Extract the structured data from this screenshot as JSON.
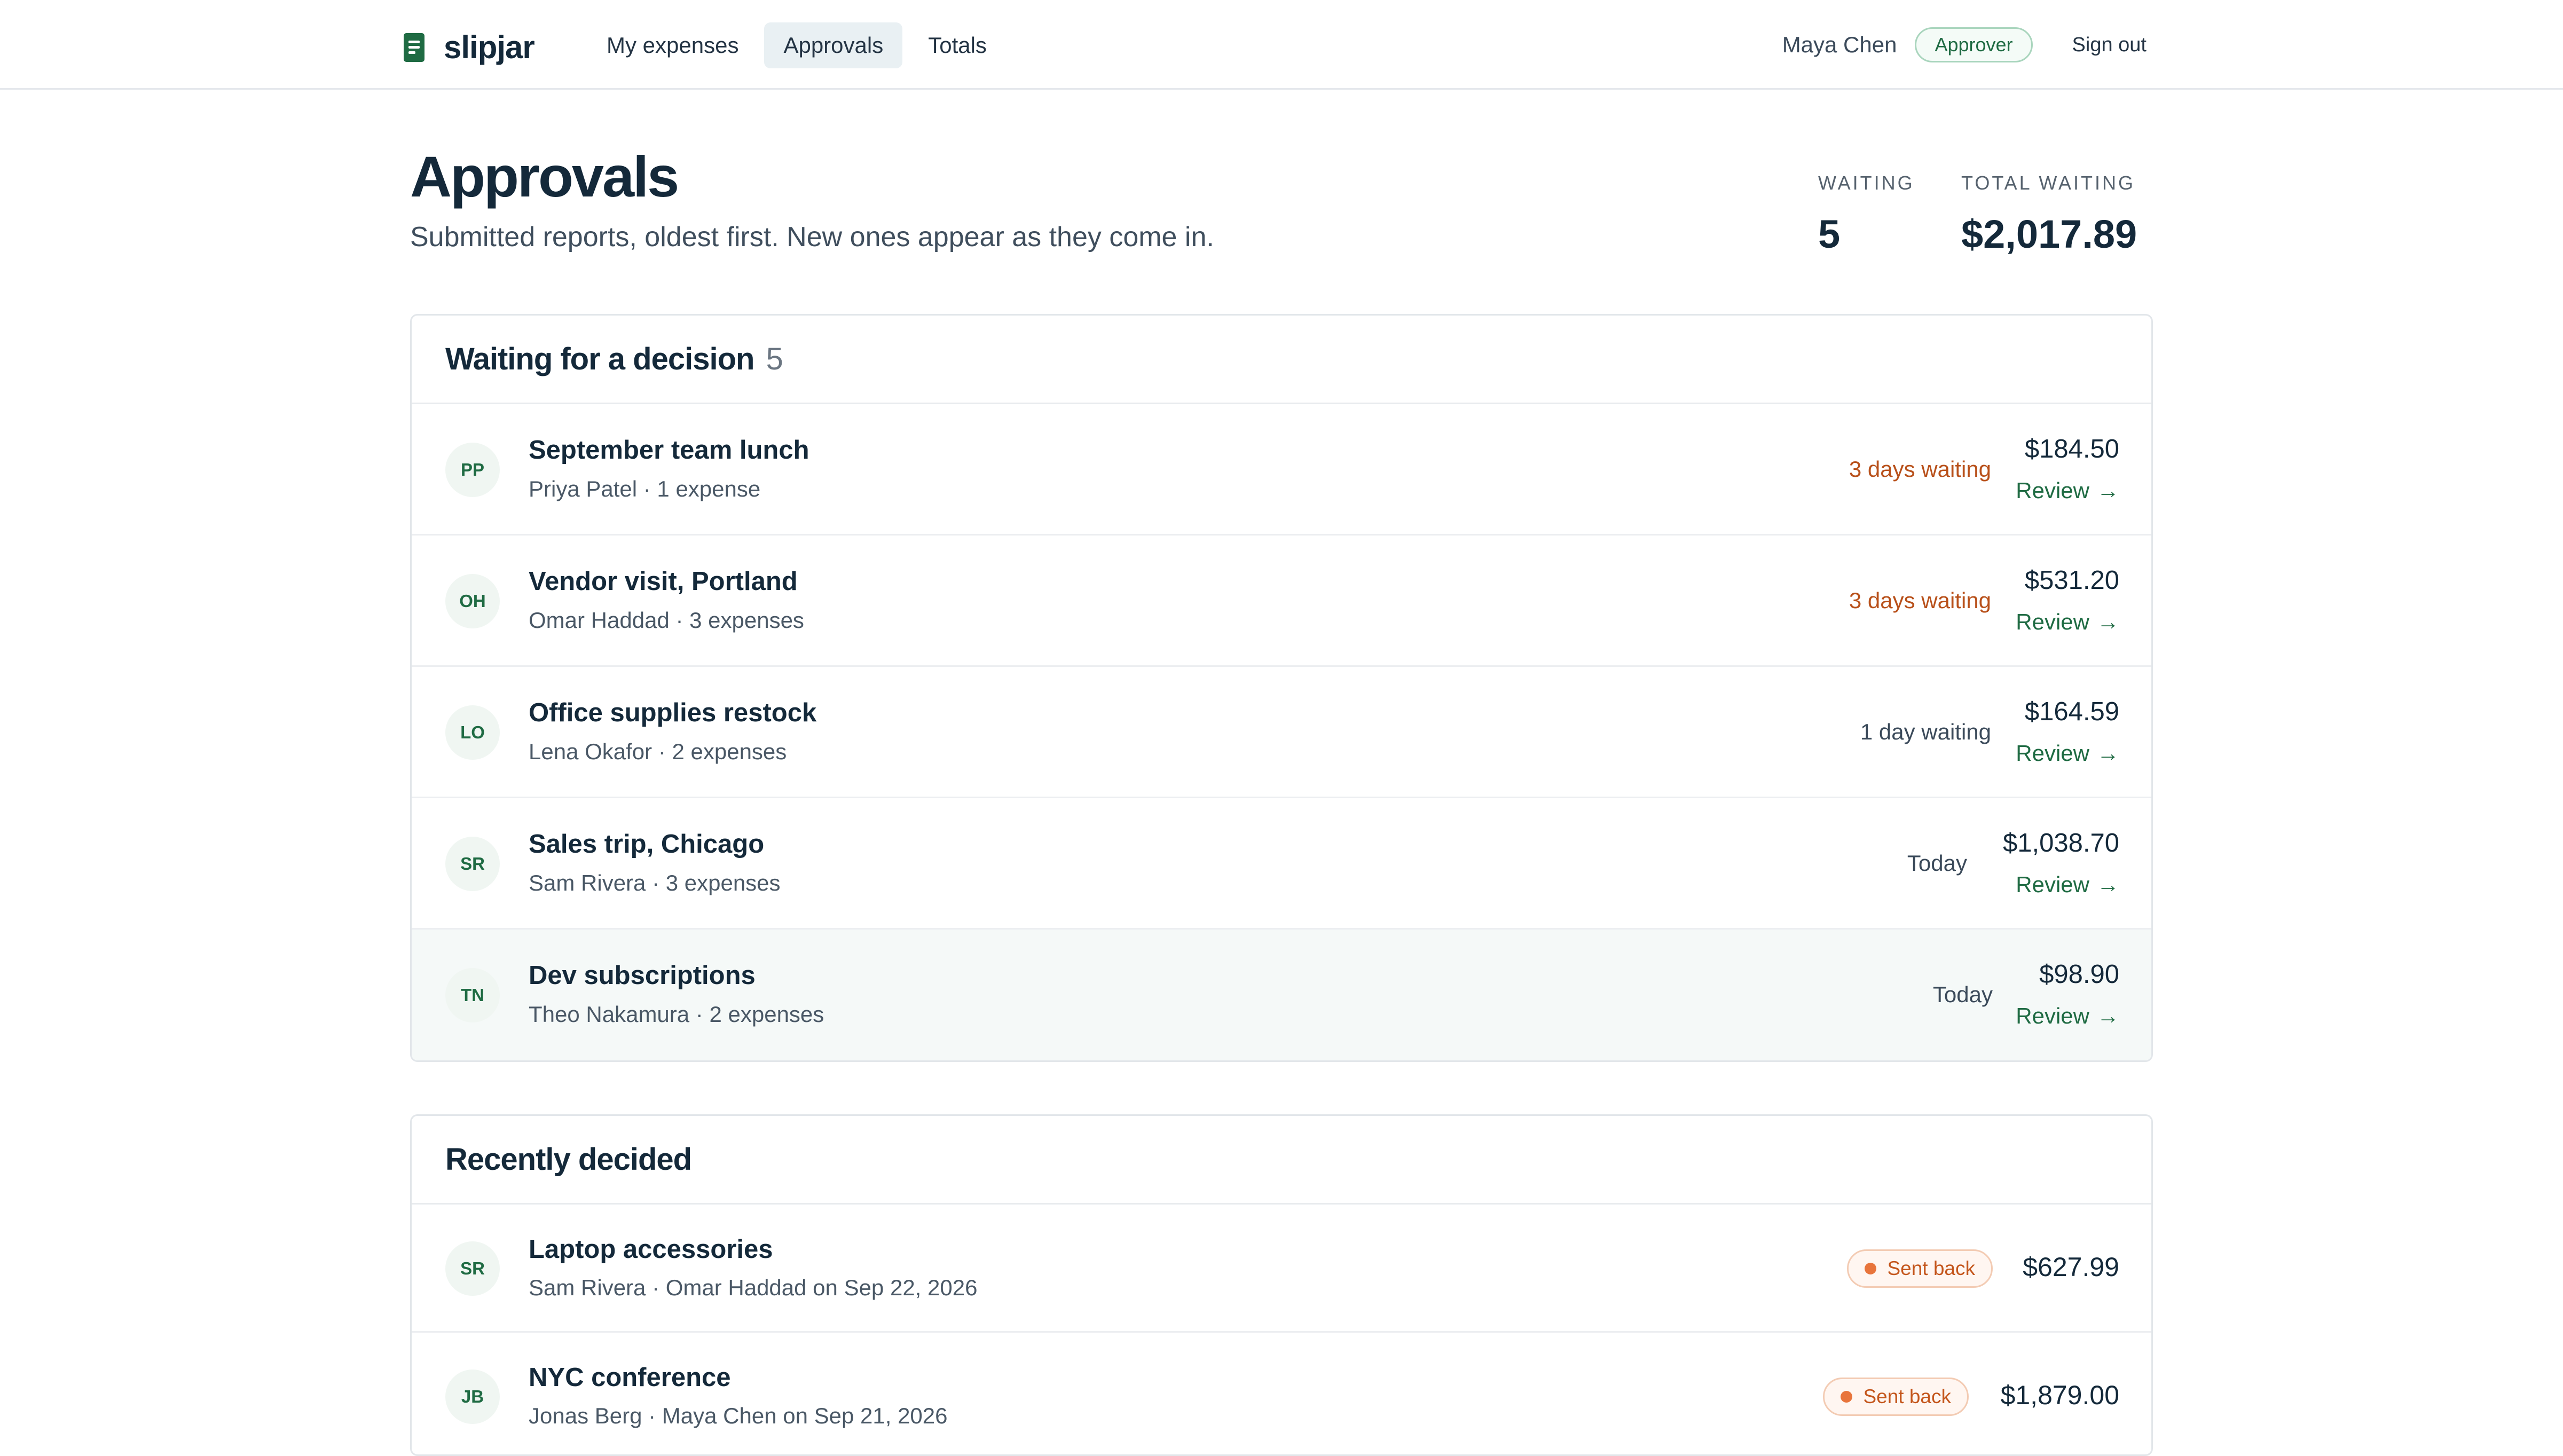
{
  "app": {
    "name": "slipjar"
  },
  "nav": {
    "tabs": [
      "My expenses",
      "Approvals",
      "Totals"
    ],
    "active": "Approvals"
  },
  "user": {
    "name": "Maya Chen",
    "role": "Approver",
    "signout_label": "Sign out"
  },
  "page": {
    "title": "Approvals",
    "subtitle": "Submitted reports, oldest first. New ones appear as they come in."
  },
  "stats": {
    "waiting_label": "WAITING",
    "waiting_value": "5",
    "total_label": "TOTAL WAITING",
    "total_value": "$2,017.89"
  },
  "waiting_section": {
    "title": "Waiting for a decision",
    "count": "5",
    "review_label": "Review",
    "rows": [
      {
        "initials": "PP",
        "title": "September team lunch",
        "meta": "Priya Patel · 1 expense",
        "waiting": "3 days waiting",
        "waiting_status": "overdue",
        "amount": "$184.50"
      },
      {
        "initials": "OH",
        "title": "Vendor visit, Portland",
        "meta": "Omar Haddad · 3 expenses",
        "waiting": "3 days waiting",
        "waiting_status": "overdue",
        "amount": "$531.20"
      },
      {
        "initials": "LO",
        "title": "Office supplies restock",
        "meta": "Lena Okafor · 2 expenses",
        "waiting": "1 day waiting",
        "waiting_status": "normal",
        "amount": "$164.59"
      },
      {
        "initials": "SR",
        "title": "Sales trip, Chicago",
        "meta": "Sam Rivera · 3 expenses",
        "waiting": "Today",
        "waiting_status": "normal",
        "amount": "$1,038.70"
      },
      {
        "initials": "TN",
        "title": "Dev subscriptions",
        "meta": "Theo Nakamura · 2 expenses",
        "waiting": "Today",
        "waiting_status": "normal",
        "amount": "$98.90"
      }
    ]
  },
  "recent_section": {
    "title": "Recently decided",
    "rows": [
      {
        "initials": "SR",
        "title": "Laptop accessories",
        "meta": "Sam Rivera · Omar Haddad on Sep 22, 2026",
        "status": "Sent back",
        "amount": "$627.99"
      },
      {
        "initials": "JB",
        "title": "NYC conference",
        "meta": "Jonas Berg · Maya Chen on Sep 21, 2026",
        "status": "Sent back",
        "amount": "$1,879.00"
      }
    ]
  },
  "icons": {
    "brand": "receipt-icon",
    "review_arrow": "arrow-right-icon",
    "status_dot": "status-dot-icon"
  },
  "colors": {
    "brand": "#1f6b43",
    "overdue": "#b8501a",
    "sent_back": "#c4561c",
    "highlight_row": "#f5f9f8"
  }
}
